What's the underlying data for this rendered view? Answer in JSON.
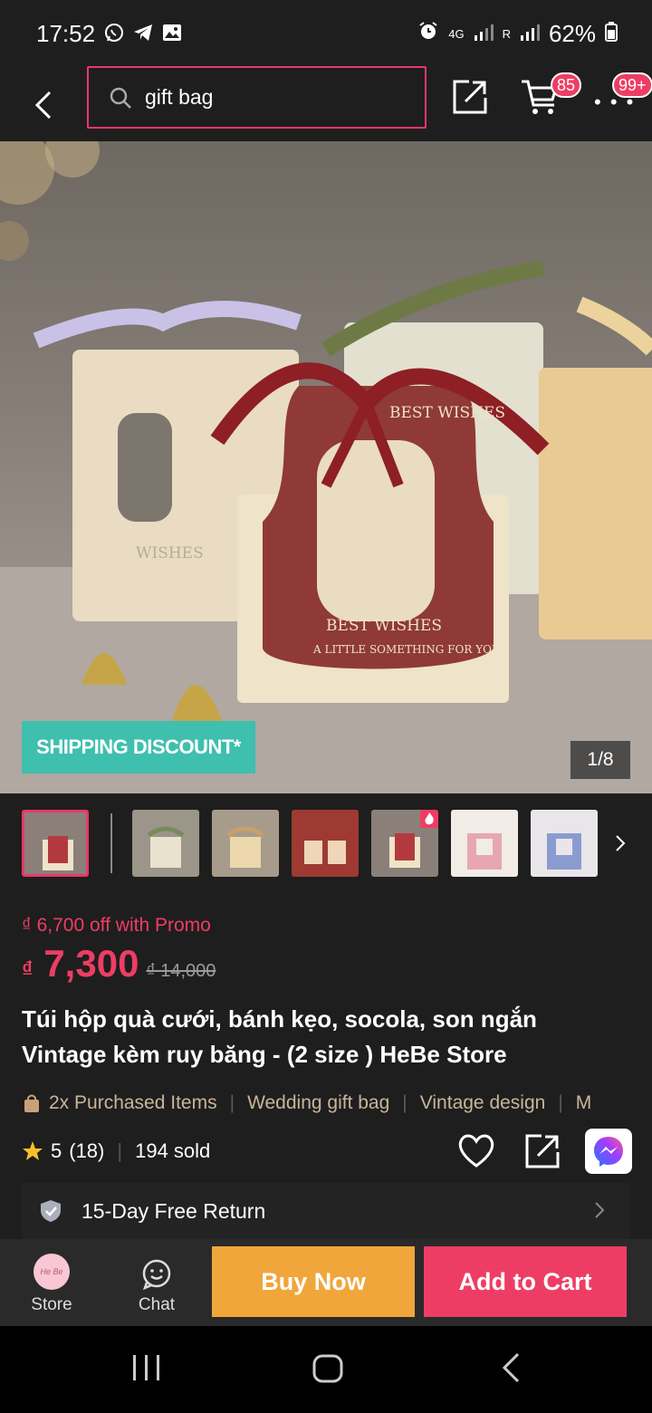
{
  "status_bar": {
    "time": "17:52",
    "network": "4G",
    "roaming": "R",
    "battery": "62%"
  },
  "top_bar": {
    "search_query": "gift bag",
    "cart_count": "85",
    "more_count": "99+"
  },
  "hero": {
    "shipping_badge": "SHIPPING DISCOUNT*",
    "page_counter": "1/8",
    "image_text": {
      "center_box_top": "BEST WISHES",
      "center_box_ring": "A LITTLE SOMETHING FOR YOU",
      "center_box_bottom": "BEST WISHES",
      "side_box": "WISHES"
    }
  },
  "thumbnails": {
    "count": 7,
    "active_index": 0,
    "colors": [
      "#b23a3f",
      "#7a8a5c",
      "#c9a06a",
      "#9e3a32",
      "#b23a3f",
      "#e6a7b3",
      "#8a9ccf"
    ]
  },
  "product": {
    "promo_text": "₫ 6,700 off with Promo",
    "currency": "₫",
    "price": "7,300",
    "original_price": "₫ 14,000",
    "title": "Túi hộp quà cưới, bánh kẹo, socola, son ngắn Vintage kèm ruy băng - (2 size ) HeBe Store",
    "tags": [
      "2x Purchased Items",
      "Wedding gift bag",
      "Vintage design",
      "M"
    ],
    "rating": "5",
    "review_count": "(18)",
    "sold": "194 sold",
    "return_policy": "15-Day Free Return"
  },
  "action_bar": {
    "store_label": "Store",
    "store_avatar_text": "He Be",
    "chat_label": "Chat",
    "buy_now_label": "Buy Now",
    "add_to_cart_label": "Add to Cart"
  },
  "colors": {
    "accent": "#ee3d64",
    "buy_now": "#f0a63b",
    "shipping_badge": "#3fbfae",
    "tag_text": "#c9b59a"
  }
}
